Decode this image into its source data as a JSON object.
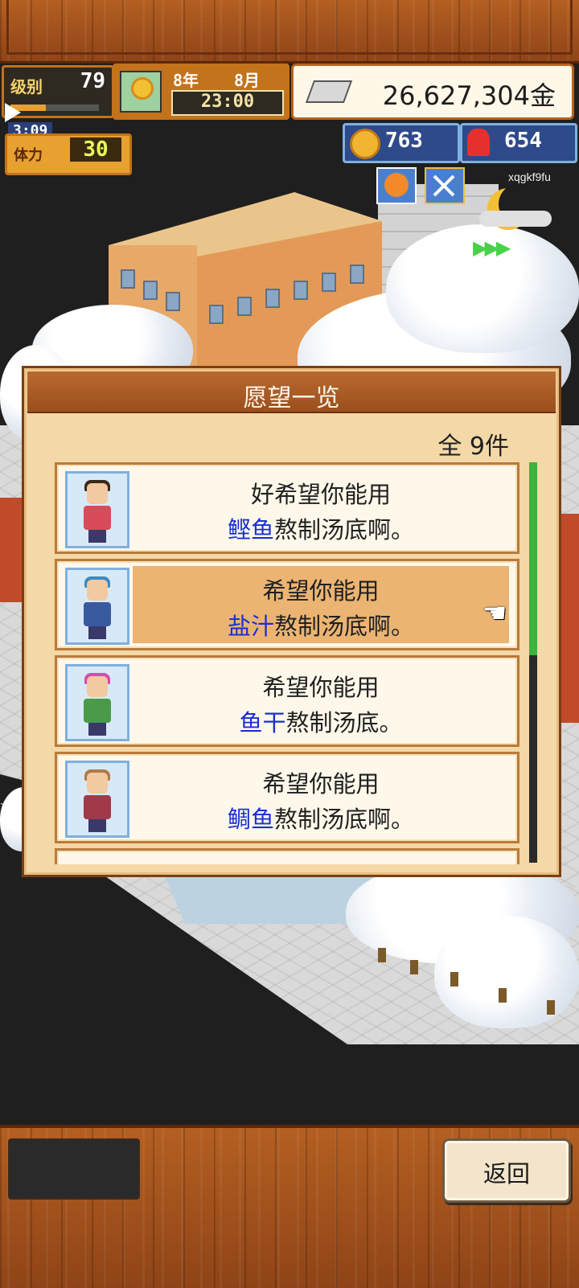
{
  "hud": {
    "level_label": "级别",
    "level_value": "79",
    "year": "8年",
    "month": "8月",
    "time": "23:00",
    "money": "26,627,304金",
    "clock_small": "3:09",
    "stamina_label": "体力",
    "stamina_value": "30",
    "coins": "763",
    "popularity": "654",
    "user_id": "xqgkf9fu"
  },
  "dialog": {
    "title": "愿望一览",
    "count": "全 9件",
    "items": [
      {
        "line1": "好希望你能用",
        "highlight": "鲣鱼",
        "rest": "熬制汤底啊。",
        "selected": false
      },
      {
        "line1": "希望你能用",
        "highlight": "盐汁",
        "rest": "熬制汤底啊。",
        "selected": true
      },
      {
        "line1": "希望你能用",
        "highlight": "鱼干",
        "rest": "熬制汤底。",
        "selected": false
      },
      {
        "line1": "希望你能用",
        "highlight": "鲷鱼",
        "rest": "熬制汤底啊。",
        "selected": false
      }
    ]
  },
  "footer": {
    "back_label": "返回"
  },
  "colors": {
    "highlight_text": "#1a2fd6",
    "selected_row": "#ebb472",
    "scrollbar": "#3cb33c"
  }
}
